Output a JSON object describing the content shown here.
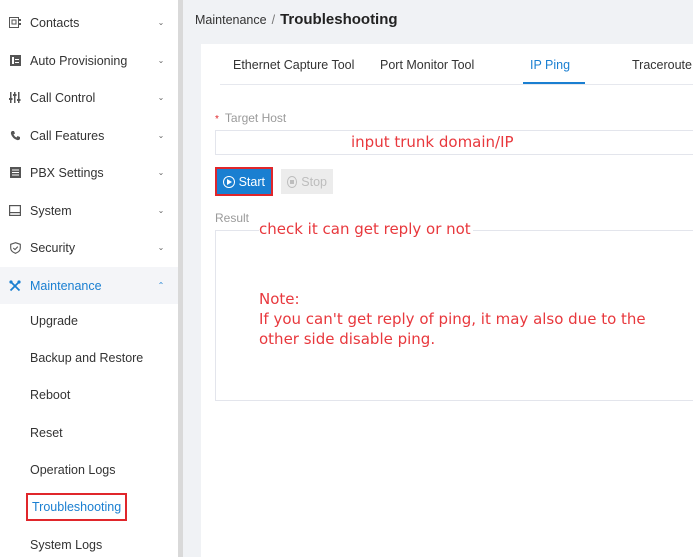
{
  "sidebar": {
    "items": [
      {
        "label": "Contacts",
        "icon": "contacts-icon",
        "expanded": false
      },
      {
        "label": "Auto Provisioning",
        "icon": "auto-provisioning-icon",
        "expanded": false
      },
      {
        "label": "Call Control",
        "icon": "call-control-icon",
        "expanded": false
      },
      {
        "label": "Call Features",
        "icon": "call-features-icon",
        "expanded": false
      },
      {
        "label": "PBX Settings",
        "icon": "pbx-settings-icon",
        "expanded": false
      },
      {
        "label": "System",
        "icon": "system-icon",
        "expanded": false
      },
      {
        "label": "Security",
        "icon": "security-icon",
        "expanded": false
      },
      {
        "label": "Maintenance",
        "icon": "maintenance-icon",
        "expanded": true
      }
    ],
    "maintenance_sub": [
      {
        "label": "Upgrade"
      },
      {
        "label": "Backup and Restore"
      },
      {
        "label": "Reboot"
      },
      {
        "label": "Reset"
      },
      {
        "label": "Operation Logs"
      },
      {
        "label": "Troubleshooting",
        "active": true
      },
      {
        "label": "System Logs"
      }
    ]
  },
  "breadcrumb": {
    "parent": "Maintenance",
    "separator": "/",
    "current": "Troubleshooting"
  },
  "tabs": [
    {
      "label": "Ethernet Capture Tool"
    },
    {
      "label": "Port Monitor Tool"
    },
    {
      "label": "IP Ping",
      "active": true
    },
    {
      "label": "Traceroute"
    }
  ],
  "form": {
    "target_host": {
      "required_mark": "*",
      "label": "Target Host",
      "value": ""
    },
    "start_label": "Start",
    "stop_label": "Stop",
    "result_label": "Result",
    "result_value": ""
  },
  "annotations": {
    "input_hint": "input trunk domain/IP",
    "result_hint": "check it can get reply or not",
    "note_title": "Note:",
    "note_body": "If you can't get reply of ping, it may also due to the other side disable ping."
  },
  "colors": {
    "accent": "#1a7fd1",
    "annotation": "#e8383d",
    "highlight_border": "#e0262b"
  }
}
